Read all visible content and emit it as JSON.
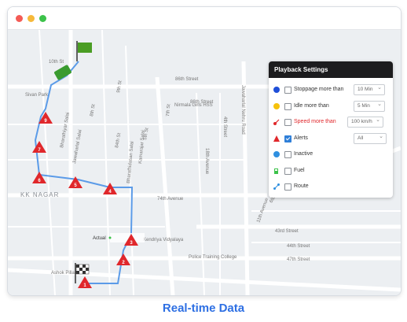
{
  "colors": {
    "window_dot_red": "#f45b55",
    "window_dot_yellow": "#f6b93b",
    "window_dot_green": "#3cc24a",
    "route": "#5b9be8",
    "alert": "#e0272b",
    "caption": "#2d6fe3"
  },
  "map": {
    "area_label": "KK NAGAR",
    "street_labels": {
      "s86_top": "86th Street",
      "s86_mid": "86th Street",
      "s74": "74th Avenue",
      "s10": "10th St",
      "s9": "9th St",
      "s8": "8th St",
      "s7": "7th St",
      "s4": "4th Street",
      "s84": "84th St",
      "s7th": "7th Avenue",
      "s5": "5th St",
      "s69": "69th Avenue",
      "s43": "43rd Street",
      "s44": "44th Street",
      "s47": "47th Street",
      "s18": "18th Avenue",
      "s11": "11th Avenue",
      "jawaharlal": "Jawaharlal Nehru Road",
      "kamarajar": "Kamarajar Salai",
      "bharathidasan": "Bharathidasan Salai",
      "jawaharlal_salai": "Jawaharlal Salai",
      "bharathiyar": "Bharathiyar Salai",
      "chinmaya": "Ashok Pillar",
      "sivan_park": "Sivan Park",
      "nirmala": "Nirmala Girls HSS",
      "police": "Police Training College",
      "kendriya": "Kendriya Vidyalaya",
      "actual": "Actual"
    },
    "route_markers": [
      "1",
      "2",
      "3",
      "4",
      "5",
      "6",
      "7",
      "9"
    ]
  },
  "panel": {
    "title": "Playback Settings",
    "rows": [
      {
        "label": "Stoppage more than",
        "icon": "blue-dot-icon",
        "checked": false,
        "select": "10 Min"
      },
      {
        "label": "Idle more than",
        "icon": "yellow-dot-icon",
        "checked": false,
        "select": "5 Min"
      },
      {
        "label": "Speed more than",
        "icon": "speed-icon",
        "checked": false,
        "select": "100 km/h"
      },
      {
        "label": "Alerts",
        "icon": "alert-triangle-icon",
        "checked": true,
        "select": "All"
      },
      {
        "label": "Inactive",
        "icon": "inactive-dot-icon",
        "checked": false
      },
      {
        "label": "Fuel",
        "icon": "fuel-icon",
        "checked": false
      },
      {
        "label": "Route",
        "icon": "route-icon",
        "checked": false
      }
    ]
  },
  "caption": "Real-time Data"
}
